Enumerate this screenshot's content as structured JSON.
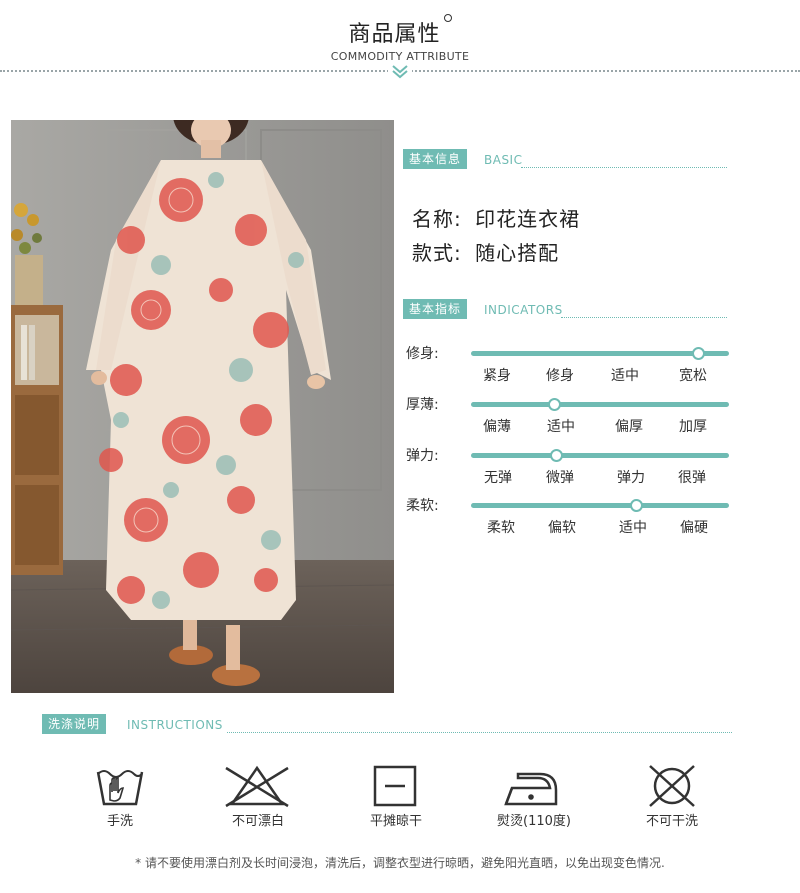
{
  "header": {
    "title": "商品属性",
    "subtitle": "COMMODITY ATTRIBUTE"
  },
  "basic": {
    "tag": "基本信息",
    "tag_en": "BASIC",
    "name_label": "名称:",
    "name_value": "印花连衣裙",
    "style_label": "款式:",
    "style_value": "随心搭配"
  },
  "indicators": {
    "tag": "基本指标",
    "tag_en": "INDICATORS",
    "rows": [
      {
        "label": "修身:",
        "options": [
          "紧身",
          "修身",
          "适中",
          "宽松"
        ],
        "level": 0.88
      },
      {
        "label": "厚薄:",
        "options": [
          "偏薄",
          "适中",
          "偏厚",
          "加厚"
        ],
        "level": 0.32
      },
      {
        "label": "弹力:",
        "options": [
          "无弹",
          "微弹",
          "弹力",
          "很弹"
        ],
        "level": 0.33
      },
      {
        "label": "柔软:",
        "options": [
          "柔软",
          "偏软",
          "适中",
          "偏硬"
        ],
        "level": 0.64
      }
    ]
  },
  "instructions": {
    "tag": "洗涤说明",
    "tag_en": "INSTRUCTIONS",
    "items": [
      {
        "icon": "hand-wash-icon",
        "label": "手洗"
      },
      {
        "icon": "no-bleach-icon",
        "label": "不可漂白"
      },
      {
        "icon": "flat-dry-icon",
        "label": "平摊晾干"
      },
      {
        "icon": "iron-icon",
        "label": "熨烫(110度)"
      },
      {
        "icon": "no-tumble-dry-icon",
        "label": "不可干洗"
      }
    ],
    "note": "* 请不要使用漂白剂及长时间浸泡，清洗后，调整衣型进行晾晒，避免阳光直晒，以免出现变色情况."
  },
  "colors": {
    "accent": "#6fbbb3",
    "dress_base": "#efe3d5",
    "print_red": "#e0574e",
    "print_teal": "#8fb9b2"
  }
}
